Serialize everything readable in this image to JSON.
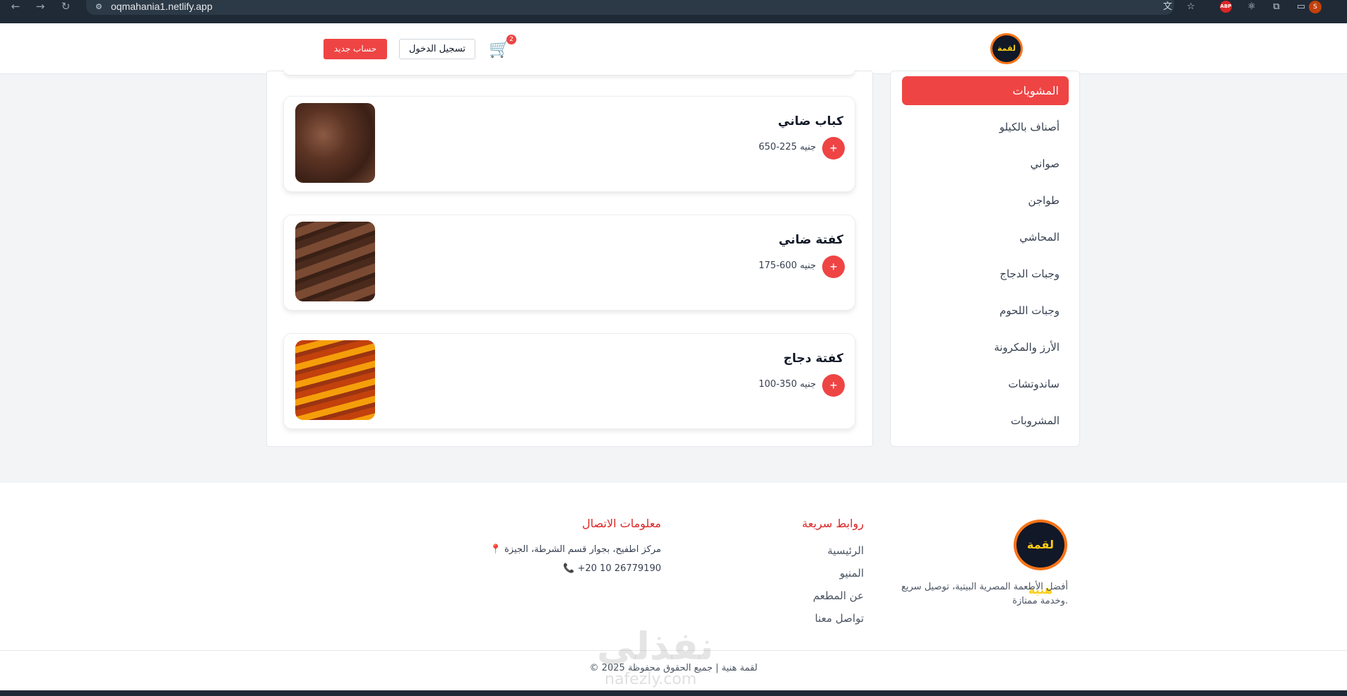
{
  "browser": {
    "url": "oqmahania1.netlify.app",
    "back_icon": "←",
    "forward_icon": "→",
    "reload_icon": "↻",
    "site_info_icon": "⚙",
    "profile_initial": "S",
    "abp_label": "ABP"
  },
  "header": {
    "logo_text": "لقمة هنية",
    "cart_icon": "🛒",
    "cart_count": "2",
    "login_label": "تسجيل الدخول",
    "register_label": "حساب جديد"
  },
  "sidebar": {
    "active": "المشويات",
    "items": [
      "أصناف بالكيلو",
      "صواني",
      "طواجن",
      "المحاشي",
      "وجبات الدجاج",
      "وجبات اللحوم",
      "الأرز والمكرونة",
      "ساندوتشات",
      "المشروبات"
    ]
  },
  "menu": {
    "add_symbol": "+",
    "items": [
      {
        "name": "كباب ضاني",
        "price": "650-225 جنيه",
        "image": "kebab"
      },
      {
        "name": "كفتة ضاني",
        "price": "175-600 جنيه",
        "image": "kofta"
      },
      {
        "name": "كفتة دجاج",
        "price": "100-350 جنيه",
        "image": "chicken-kofta"
      }
    ]
  },
  "footer": {
    "logo_text": "لقمة هنية",
    "description": "أفضل الأطعمة المصرية البيتية، توصيل سريع وخدمة ممتازة.",
    "quick_links": {
      "heading": "روابط سريعة",
      "items": [
        "الرئيسية",
        "المنيو",
        "عن المطعم",
        "تواصل معنا"
      ]
    },
    "contact": {
      "heading": "معلومات الاتصال",
      "address_icon": "📍",
      "address": "مركز اطفيح، بجوار قسم الشرطة، الجيزة",
      "phone_icon": "📞",
      "phone": "+20 10 26779190"
    },
    "copyright": "© 2025 لقمة هنية | جميع الحقوق محفوظة",
    "watermark": "نفذلي",
    "watermark_sub": "nafezly.com"
  },
  "colors": {
    "accent": "#ef4444",
    "heading_red": "#dc2626",
    "chrome": "#1f2a36"
  }
}
